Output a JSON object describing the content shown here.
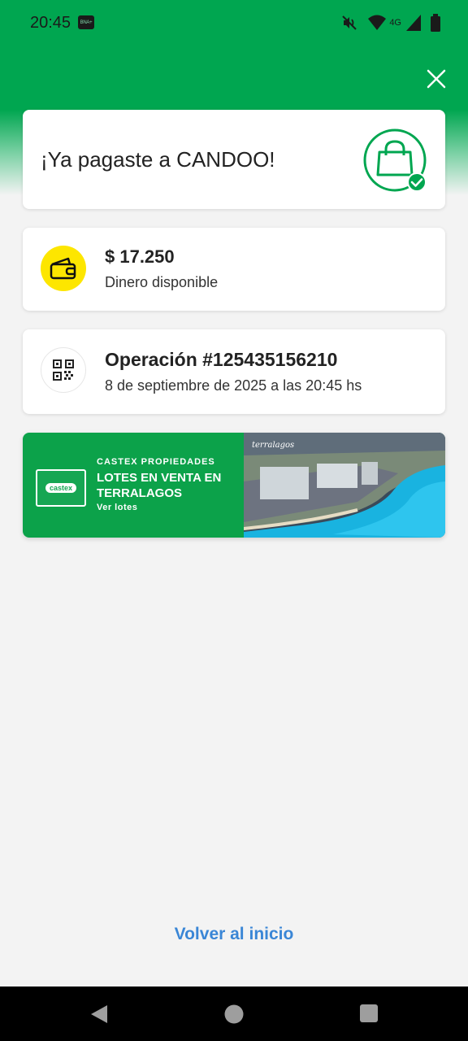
{
  "status_bar": {
    "time": "20:45",
    "badge": "BNA+",
    "network": "4G",
    "icons": [
      "mute-icon",
      "wifi-icon",
      "signal-icon",
      "battery-icon"
    ]
  },
  "header": {
    "close_icon": "close-icon",
    "background_color": "#00a650"
  },
  "success_card": {
    "title": "¡Ya pagaste a CANDOO!",
    "icon": "shopping-bag-check-icon",
    "accent_color": "#00a650"
  },
  "balance_card": {
    "amount": "$ 17.250",
    "label": "Dinero disponible",
    "icon": "wallet-icon",
    "icon_bg": "#fde600"
  },
  "operation_card": {
    "title": "Operación #125435156210",
    "date": "8 de septiembre de 2025 a las 20:45 hs",
    "icon": "qr-code-icon"
  },
  "banner": {
    "logo_text": "castex",
    "kicker": "CASTEX PROPIEDADES",
    "title": "LOTES EN VENTA EN TERRALAGOS",
    "cta": "Ver lotes",
    "photo_caption": "terralagos",
    "color": "#0ca24a"
  },
  "footer": {
    "back_link": "Volver al inicio",
    "link_color": "#3a86d6"
  },
  "nav_bar": {
    "buttons": [
      "back-triangle-icon",
      "home-circle-icon",
      "recents-square-icon"
    ]
  }
}
